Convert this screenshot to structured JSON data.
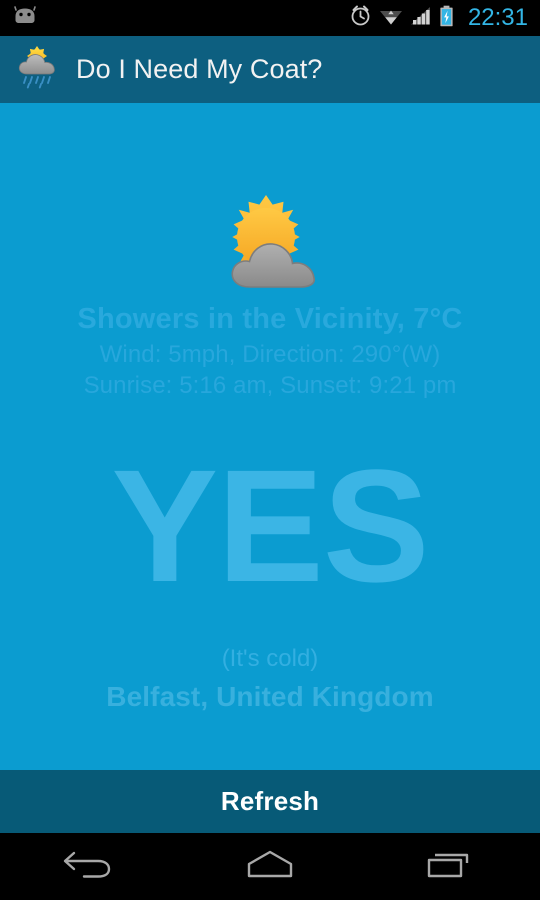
{
  "statusbar": {
    "notification_icon": "android-robot-icon",
    "icons": [
      "alarm-clock-icon",
      "wifi-icon",
      "cellular-signal-icon",
      "battery-charging-icon"
    ],
    "clock": "22:31",
    "clock_color": "#33b5e5"
  },
  "actionbar": {
    "app_icon": "sun-rain-cloud-icon",
    "title": "Do I Need My Coat?",
    "background_color": "#0d5f80"
  },
  "main": {
    "background_color": "#0b9cd0",
    "weather_icon": "sun-behind-cloud-icon",
    "condition": "Showers in the Vicinity, 7°C",
    "wind": "Wind: 5mph, Direction: 290°(W)",
    "sun_times": "Sunrise: 5:16 am, Sunset: 9:21 pm",
    "verdict": "YES",
    "verdict_color": "#3bb5e5",
    "reason": "(It's cold)",
    "location": "Belfast, United Kingdom"
  },
  "refresh": {
    "label": "Refresh",
    "background_color": "#075a77"
  },
  "navbar": {
    "back": "back-icon",
    "home": "home-icon",
    "recents": "recent-apps-icon"
  }
}
